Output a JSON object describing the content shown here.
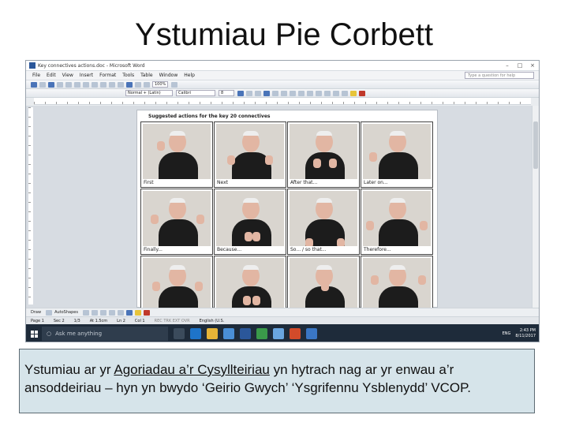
{
  "slide": {
    "title": "Ystumiau Pie Corbett"
  },
  "window": {
    "title": "Key connectives actions.doc - Microsoft Word",
    "controls": [
      "–",
      "□",
      "×"
    ]
  },
  "menu": {
    "items": [
      "File",
      "Edit",
      "View",
      "Insert",
      "Format",
      "Tools",
      "Table",
      "Window",
      "Help"
    ],
    "ask_placeholder": "Type a question for help"
  },
  "toolbar": {
    "zoom": "100%",
    "style": "Normal + (Latin)",
    "font": "Calibri",
    "size": "8"
  },
  "document": {
    "heading": "Suggested actions for the key 20 connectives",
    "cells": [
      {
        "caption": "First"
      },
      {
        "caption": "Next"
      },
      {
        "caption": "After that..."
      },
      {
        "caption": "Later on..."
      },
      {
        "caption": "Finally..."
      },
      {
        "caption": "Because..."
      },
      {
        "caption": "So... / so that..."
      },
      {
        "caption": "Therefore..."
      },
      {
        "caption": ""
      },
      {
        "caption": ""
      },
      {
        "caption": ""
      },
      {
        "caption": ""
      }
    ]
  },
  "drawbar": {
    "draw": "Draw",
    "autoshapes": "AutoShapes"
  },
  "status": {
    "page": "Page 1",
    "sec": "Sec 2",
    "pages": "1/3",
    "at": "At 1.5cm",
    "ln": "Ln 2",
    "col": "Col 1",
    "modes": "REC  TRK  EXT  OVR",
    "lang": "English (U.S."
  },
  "taskbar": {
    "search_placeholder": "Ask me anything",
    "lang": "ENG",
    "time": "2:43 PM",
    "date": "8/11/2017"
  },
  "caption": {
    "part1": "Ystumiau ar yr ",
    "underlined": "Agoriadau a’r Cysyllteiriau",
    "part2": " yn hytrach nag ar yr enwau a’r ansoddeiriau – hyn yn bwydo ‘Geirio Gwych’ ‘Ysgrifennu Ysblenydd’ VCOP."
  }
}
